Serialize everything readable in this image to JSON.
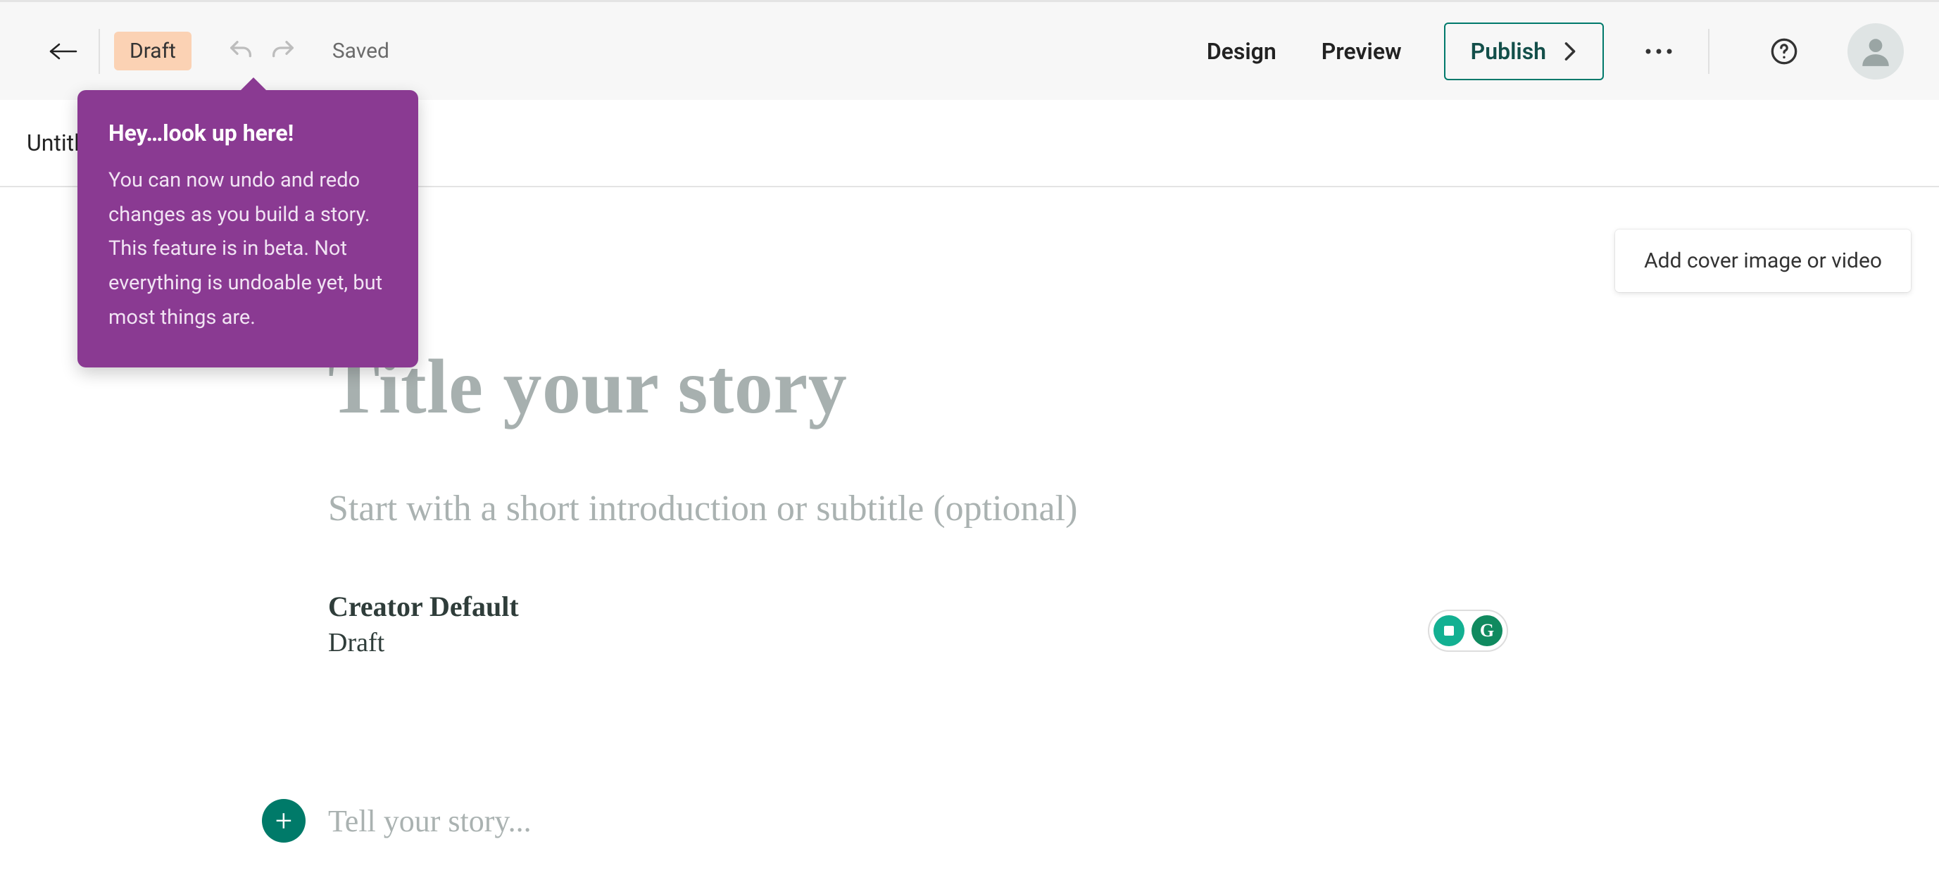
{
  "toolbar": {
    "draft_label": "Draft",
    "saved_label": "Saved",
    "design_label": "Design",
    "preview_label": "Preview",
    "publish_label": "Publish"
  },
  "tabs": {
    "tab1": "Untitled"
  },
  "tooltip": {
    "title": "Hey…look up here!",
    "body": "You can now undo and redo changes as you build a story. This feature is in beta. Not everything is undoable yet, but most things are."
  },
  "cover": {
    "button_label": "Add cover image or video"
  },
  "editor": {
    "title_placeholder": "Title your story",
    "subtitle_placeholder": "Start with a short introduction or subtitle (optional)",
    "body_placeholder": "Tell your story..."
  },
  "byline": {
    "creator": "Creator Default",
    "status": "Draft"
  },
  "grammarly": {
    "g_label": "G"
  },
  "icons": {
    "back": "back-arrow-icon",
    "undo": "undo-icon",
    "redo": "redo-icon",
    "chevron": "chevron-right-icon",
    "more": "more-horizontal-icon",
    "help": "help-circle-icon",
    "avatar": "avatar-icon",
    "plus": "plus-icon"
  },
  "colors": {
    "accent_teal": "#007a69",
    "tooltip_purple": "#8a3a92",
    "draft_peach": "#fbd2b4"
  }
}
